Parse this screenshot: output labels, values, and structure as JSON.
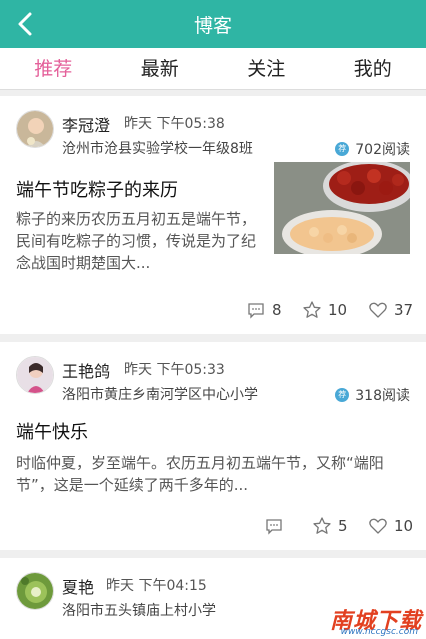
{
  "header": {
    "title": "博客",
    "back_icon": "chevron-left-icon"
  },
  "tabs": [
    {
      "label": "推荐",
      "active": true
    },
    {
      "label": "最新",
      "active": false
    },
    {
      "label": "关注",
      "active": false
    },
    {
      "label": "我的",
      "active": false
    }
  ],
  "posts": [
    {
      "author": "李冠澄",
      "time": "昨天 下午05:38",
      "school": "沧州市沧县实验学校一年级8班",
      "badge": "荐",
      "reads": "702阅读",
      "title": "端午节吃粽子的来历",
      "excerpt": "粽子的来历农历五月初五是端午节，民间有吃粽子的习惯，传说是为了纪念战国时期楚国大...",
      "comments": "8",
      "favorites": "10",
      "likes": "37"
    },
    {
      "author": "王艳鸽",
      "time": "昨天 下午05:33",
      "school": "洛阳市黄庄乡南河学区中心小学",
      "badge": "荐",
      "reads": "318阅读",
      "title": "端午快乐",
      "excerpt": "时临仲夏，岁至端午。农历五月初五端午节，又称“端阳节”，这是一个延续了两千多年的...",
      "comments": "",
      "favorites": "5",
      "likes": "10"
    },
    {
      "author": "夏艳",
      "time": "昨天 下午04:15",
      "school": "洛阳市五头镇庙上村小学"
    }
  ],
  "watermark": {
    "brand": "南城下载",
    "url": "www.nccgsc.com"
  },
  "colors": {
    "header_bg": "#2fb5a4",
    "tab_active": "#e4609a",
    "badge": "#49a8d6"
  }
}
